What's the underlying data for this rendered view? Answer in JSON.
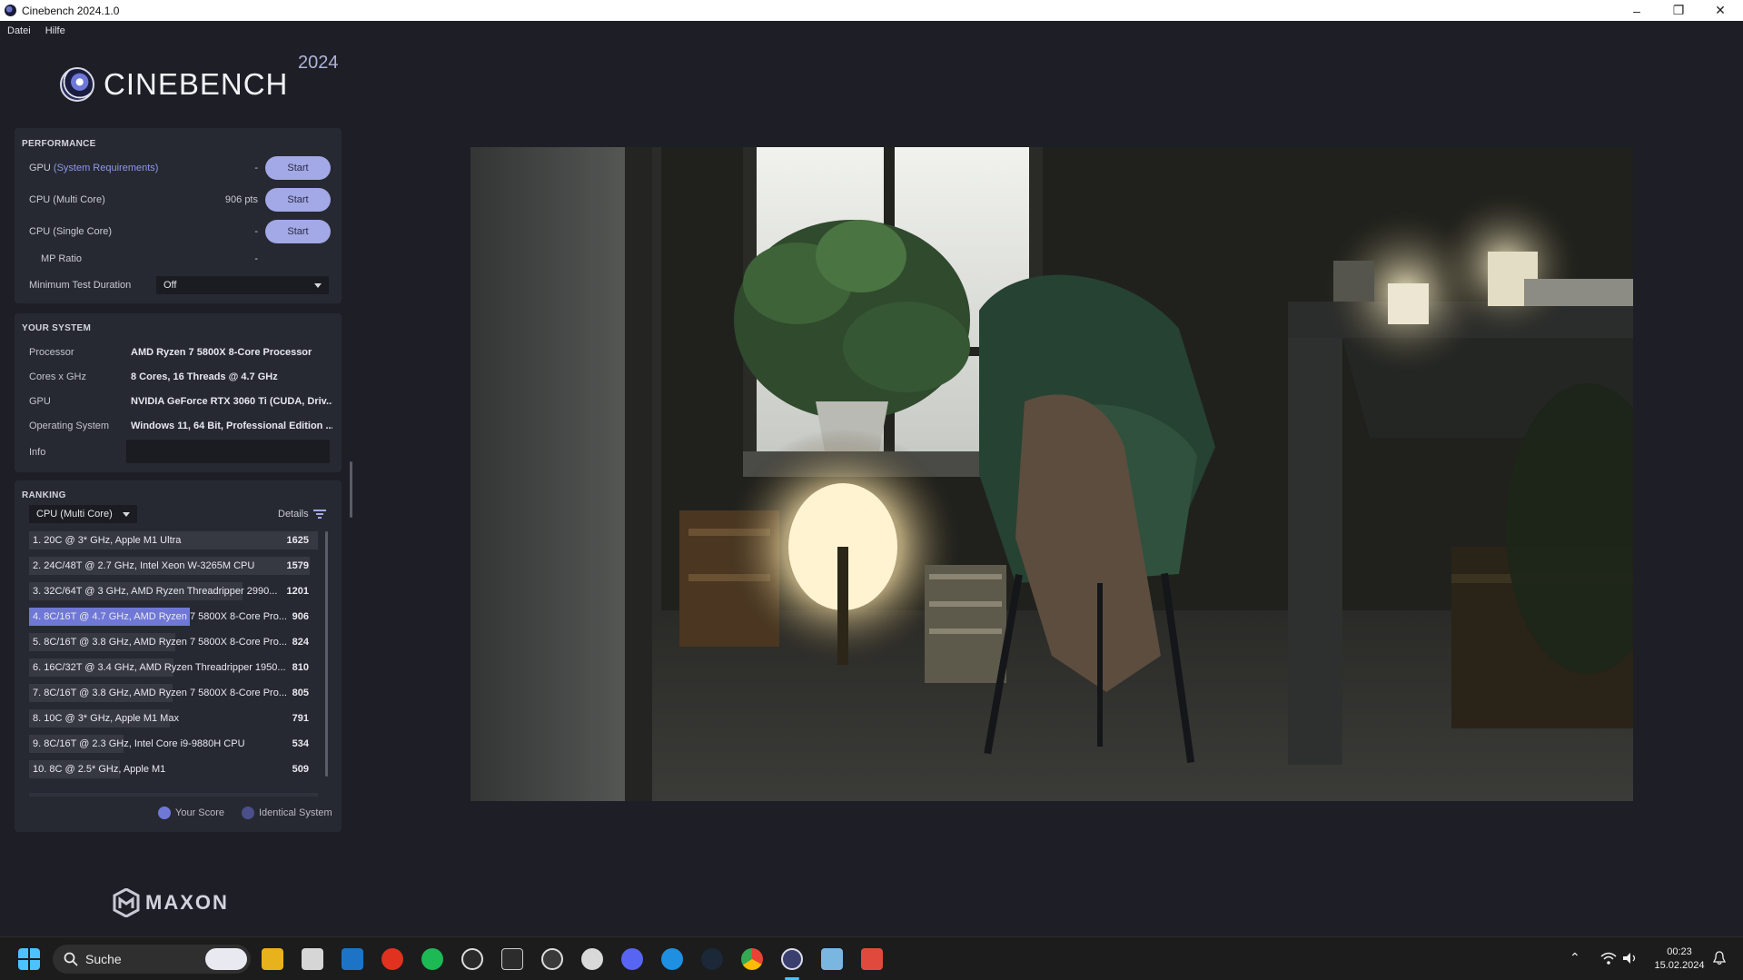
{
  "window": {
    "title": "Cinebench 2024.1.0",
    "minimize": "–",
    "restore": "❐",
    "close": "✕"
  },
  "menu": [
    "Datei",
    "Hilfe"
  ],
  "logo": {
    "name": "CINEBENCH",
    "year": "2024"
  },
  "performance": {
    "title": "PERFORMANCE",
    "rows": [
      {
        "label": "GPU",
        "link": "(System Requirements)",
        "value": "-",
        "button": "Start"
      },
      {
        "label": "CPU (Multi Core)",
        "value": "906 pts",
        "button": "Start"
      },
      {
        "label": "CPU (Single Core)",
        "value": "-",
        "button": "Start"
      }
    ],
    "mp_ratio": {
      "label": "MP Ratio",
      "value": "-"
    },
    "min_duration": {
      "label": "Minimum Test Duration",
      "value": "Off"
    }
  },
  "system": {
    "title": "YOUR SYSTEM",
    "rows": [
      {
        "key": "Processor",
        "value": "AMD Ryzen 7 5800X 8-Core Processor"
      },
      {
        "key": "Cores x GHz",
        "value": "8 Cores, 16 Threads @ 4.7 GHz"
      },
      {
        "key": "GPU",
        "value": "NVIDIA GeForce RTX 3060 Ti (CUDA, Driv..."
      },
      {
        "key": "Operating System",
        "value": "Windows 11, 64 Bit, Professional Edition ..."
      }
    ],
    "info_label": "Info"
  },
  "ranking": {
    "title": "RANKING",
    "selector": "CPU (Multi Core)",
    "details": "Details",
    "max_score": 1625,
    "rows": [
      {
        "name": "1. 20C @ 3* GHz, Apple M1 Ultra",
        "score": 1625,
        "highlight": false
      },
      {
        "name": "2. 24C/48T @ 2.7 GHz, Intel Xeon W-3265M CPU",
        "score": 1579,
        "highlight": false
      },
      {
        "name": "3. 32C/64T @ 3 GHz, AMD Ryzen Threadripper 2990...",
        "score": 1201,
        "highlight": false
      },
      {
        "name": "4. 8C/16T @ 4.7 GHz, AMD Ryzen 7 5800X 8-Core Pro...",
        "score": 906,
        "highlight": true
      },
      {
        "name": "5. 8C/16T @ 3.8 GHz, AMD Ryzen 7 5800X 8-Core Pro...",
        "score": 824,
        "highlight": false
      },
      {
        "name": "6. 16C/32T @ 3.4 GHz, AMD Ryzen Threadripper 1950...",
        "score": 810,
        "highlight": false
      },
      {
        "name": "7. 8C/16T @ 3.8 GHz, AMD Ryzen 7 5800X 8-Core Pro...",
        "score": 805,
        "highlight": false
      },
      {
        "name": "8. 10C @ 3* GHz, Apple M1 Max",
        "score": 791,
        "highlight": false
      },
      {
        "name": "9. 8C/16T @ 2.3 GHz, Intel Core i9-9880H CPU",
        "score": 534,
        "highlight": false
      },
      {
        "name": "10. 8C @ 2.5* GHz, Apple M1",
        "score": 509,
        "highlight": false
      }
    ],
    "legend": {
      "your_score": "Your Score",
      "identical": "Identical System",
      "your_color": "#7078d6",
      "identical_color": "#4a4f8a"
    }
  },
  "brand": "MAXON",
  "taskbar": {
    "search_placeholder": "Suche",
    "time": "00:23",
    "date": "15.02.2024",
    "apps": [
      "windows-start",
      "file-explorer",
      "microsoft-store",
      "outlook",
      "ea-app",
      "spotify",
      "logitech-g-hub",
      "epic-games",
      "obs-studio",
      "ubisoft-connect",
      "discord",
      "battle-net",
      "steam",
      "chrome",
      "cinebench",
      "task-manager",
      "app-installer"
    ]
  }
}
